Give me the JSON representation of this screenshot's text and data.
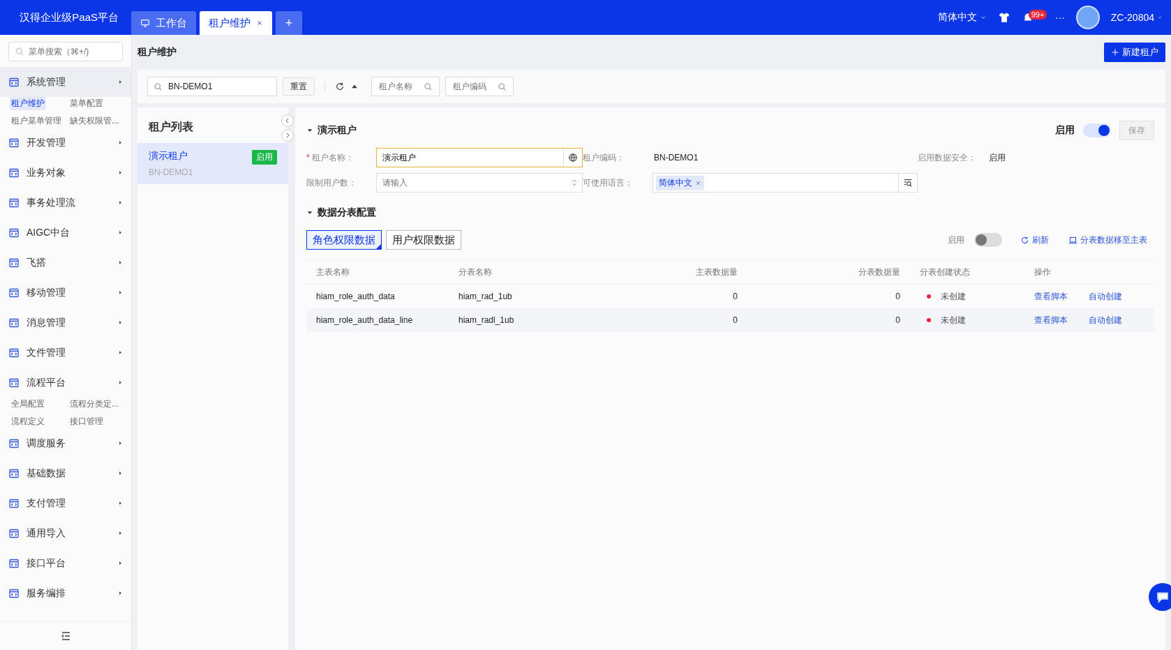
{
  "app": {
    "title": "汉得企业级PaaS平台"
  },
  "tabs": [
    {
      "label": "工作台",
      "kind": "home",
      "selected": false
    },
    {
      "label": "租户维护",
      "kind": "page",
      "selected": true
    },
    {
      "label": "+",
      "kind": "add",
      "selected": false
    }
  ],
  "header": {
    "language": "简体中文",
    "notification_count": "99+",
    "more": "···",
    "user": "ZC-20804"
  },
  "sidebar": {
    "search_placeholder": "菜单搜索（⌘+/)",
    "items": [
      {
        "label": "系统管理",
        "selected": true,
        "children": [
          {
            "label": "租户维护",
            "selected": true
          },
          {
            "label": "菜单配置",
            "selected": false
          },
          {
            "label": "租户菜单管理",
            "selected": false
          },
          {
            "label": "缺失权限管...",
            "selected": false
          }
        ]
      },
      {
        "label": "开发管理",
        "selected": false
      },
      {
        "label": "业务对象",
        "selected": false
      },
      {
        "label": "事务处理流",
        "selected": false
      },
      {
        "label": "AIGC中台",
        "selected": false
      },
      {
        "label": "飞搭",
        "selected": false
      },
      {
        "label": "移动管理",
        "selected": false
      },
      {
        "label": "消息管理",
        "selected": false
      },
      {
        "label": "文件管理",
        "selected": false
      },
      {
        "label": "流程平台",
        "selected": false,
        "children": [
          {
            "label": "全局配置",
            "selected": false
          },
          {
            "label": "流程分类定...",
            "selected": false
          },
          {
            "label": "流程定义",
            "selected": false
          },
          {
            "label": "接口管理",
            "selected": false
          }
        ]
      },
      {
        "label": "调度服务",
        "selected": false
      },
      {
        "label": "基础数据",
        "selected": false
      },
      {
        "label": "支付管理",
        "selected": false
      },
      {
        "label": "通用导入",
        "selected": false
      },
      {
        "label": "接口平台",
        "selected": false
      },
      {
        "label": "服务编排",
        "selected": false
      }
    ]
  },
  "page": {
    "title": "租户维护",
    "new_button": "新建租户"
  },
  "filter": {
    "search_value": "BN-DEMO1",
    "reset_button": "重置",
    "name_placeholder": "租户名称",
    "code_placeholder": "租户编码"
  },
  "tenant_list": {
    "title": "租户列表",
    "items": [
      {
        "name": "演示租户",
        "code": "BN-DEMO1",
        "status": "启用",
        "selected": true
      }
    ]
  },
  "detail": {
    "title": "演示租户",
    "enabled_label": "启用",
    "enabled": true,
    "save_button": "保存",
    "fields": [
      {
        "label": "租户名称：",
        "required_mark": "*",
        "kind": "text",
        "value": "演示租户"
      },
      {
        "label": "租户编码：",
        "kind": "static",
        "value": "BN-DEMO1"
      },
      {
        "label": "启用数据安全：",
        "kind": "static",
        "value": "启用"
      },
      {
        "label": "限制用户数：",
        "kind": "number",
        "placeholder": "请输入"
      },
      {
        "label": "可使用语言：",
        "kind": "tags",
        "tags": [
          "简体中文"
        ]
      }
    ]
  },
  "split_config": {
    "title": "数据分表配置",
    "tabs": [
      {
        "label": "角色权限数据",
        "selected": true
      },
      {
        "label": "用户权限数据",
        "selected": false
      }
    ],
    "enabled_label": "启用",
    "enabled": false,
    "refresh": "刷新",
    "move": "分表数据移至主表",
    "table": {
      "columns": [
        "主表名称",
        "分表名称",
        "主表数据量",
        "分表数据量",
        "分表创建状态",
        "操作"
      ],
      "rows": [
        {
          "main_table": "hiam_role_auth_data",
          "split_table": "hiam_rad_1ub",
          "main_count": "0",
          "split_count": "0",
          "status": "未创建",
          "color": "#e8253b",
          "actions": [
            "查看脚本",
            "自动创建"
          ]
        },
        {
          "main_table": "hiam_role_auth_data_line",
          "split_table": "hiam_radl_1ub",
          "main_count": "0",
          "split_count": "0",
          "status": "未创建",
          "color": "#e8253b",
          "actions": [
            "查看脚本",
            "自动创建"
          ]
        }
      ]
    }
  }
}
